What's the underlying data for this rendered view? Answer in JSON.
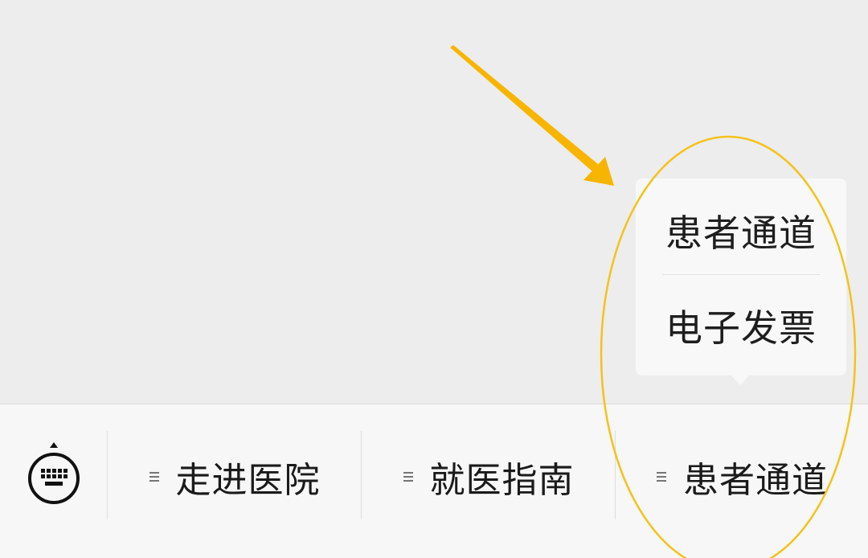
{
  "menu_bar": {
    "keyboard_button": {
      "icon": "keyboard-icon"
    },
    "items": [
      {
        "label": "走进医院",
        "icon": "menu-list-icon"
      },
      {
        "label": "就医指南",
        "icon": "menu-list-icon"
      },
      {
        "label": "患者通道",
        "icon": "menu-list-icon"
      }
    ]
  },
  "submenu": {
    "items": [
      {
        "label": "患者通道"
      },
      {
        "label": "电子发票"
      }
    ]
  },
  "annotations": {
    "arrow": "annotation-arrow",
    "highlight": "annotation-ellipse"
  },
  "colors": {
    "background": "#ededed",
    "menu_bar": "#f7f7f7",
    "submenu": "#f8f8f8",
    "text": "#1a1a1a",
    "annotation_arrow": "#f7b500",
    "annotation_ellipse": "#f5c21b"
  }
}
